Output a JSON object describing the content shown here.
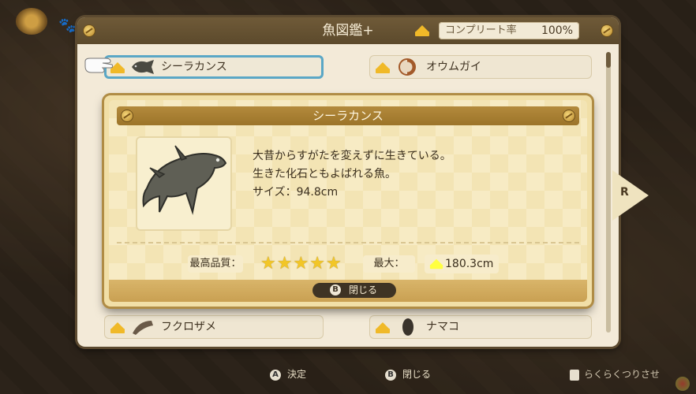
{
  "window": {
    "title": "魚図鑑+"
  },
  "completion": {
    "label": "コンプリート率",
    "value": "100%"
  },
  "list": {
    "items": [
      {
        "name": "シーラカンス",
        "icon": "coelacanth-icon",
        "selected": true
      },
      {
        "name": "オウムガイ",
        "icon": "nautilus-icon",
        "selected": false
      },
      {
        "name": "フクロザメ",
        "icon": "megamouth-icon",
        "selected": false
      },
      {
        "name": "ナマコ",
        "icon": "sea-cucumber-icon",
        "selected": false
      }
    ]
  },
  "detail": {
    "title": "シーラカンス",
    "description": [
      "大昔からすがたを変えずに生きている。",
      "生きた化石ともよばれる魚。",
      "サイズ：94.8cm"
    ],
    "quality_label": "最高品質：",
    "quality_stars": 5,
    "max_label": "最大：",
    "max_value": "180.3cm",
    "close_button": {
      "glyph": "B",
      "label": "閉じる"
    }
  },
  "side_tab": {
    "label": "R"
  },
  "footer": {
    "confirm": {
      "glyph": "A",
      "label": "決定"
    },
    "close": {
      "glyph": "B",
      "label": "閉じる"
    },
    "right_hint": "らくらくつりさせ"
  },
  "colors": {
    "accent_blue": "#5aa7c6",
    "gold": "#f0b928",
    "header_brown": "#6f5a38"
  }
}
